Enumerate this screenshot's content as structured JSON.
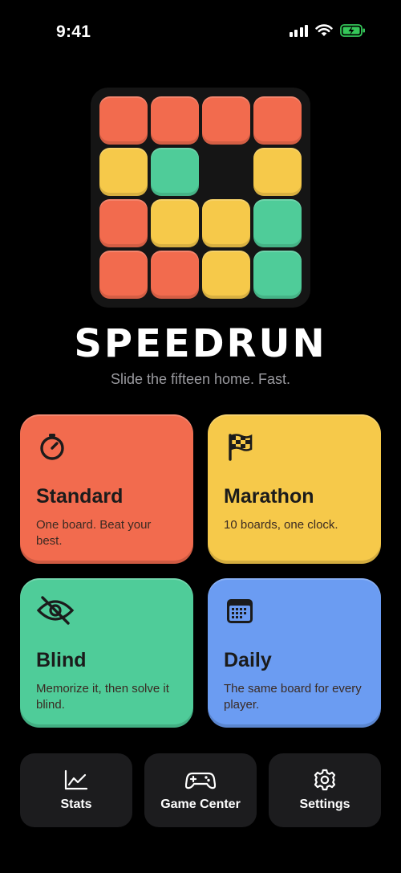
{
  "status_bar": {
    "time": "9:41"
  },
  "app": {
    "title": "SPEEDRUN",
    "tagline": "Slide the fifteen home. Fast."
  },
  "logo_tiles": {
    "colors": {
      "red": "#f26b4e",
      "yellow": "#f6c94a",
      "green": "#4fcc99"
    },
    "grid": [
      [
        "red",
        "red",
        "red",
        "red"
      ],
      [
        "yellow",
        "green",
        "",
        "yellow"
      ],
      [
        "red",
        "yellow",
        "yellow",
        "green"
      ],
      [
        "red",
        "red",
        "yellow",
        "green"
      ]
    ]
  },
  "modes": [
    {
      "title": "Standard",
      "description": "One board. Beat your best.",
      "icon": "stopwatch-icon",
      "color": "#f26b4e"
    },
    {
      "title": "Marathon",
      "description": "10 boards, one clock.",
      "icon": "checkered-flag-icon",
      "color": "#f6c94a"
    },
    {
      "title": "Blind",
      "description": "Memorize it, then solve it blind.",
      "icon": "eye-slash-icon",
      "color": "#4fcc99"
    },
    {
      "title": "Daily",
      "description": "The same board for every player.",
      "icon": "calendar-icon",
      "color": "#6b9cf2"
    }
  ],
  "bottom_nav": [
    {
      "label": "Stats",
      "icon": "chart-icon"
    },
    {
      "label": "Game Center",
      "icon": "gamepad-icon"
    },
    {
      "label": "Settings",
      "icon": "gear-icon"
    }
  ]
}
